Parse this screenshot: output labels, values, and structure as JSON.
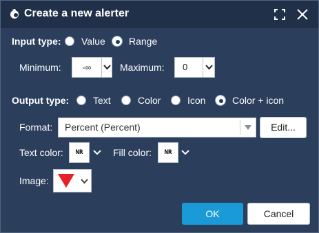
{
  "dialog": {
    "title": "Create a new alerter",
    "title_icon": "alerter-bell-icon",
    "maximize_icon": "maximize-icon",
    "close_icon": "close-icon"
  },
  "input_type": {
    "label": "Input type:",
    "options": [
      "Value",
      "Range"
    ],
    "selected": "Range"
  },
  "range": {
    "minimum_label": "Minimum:",
    "minimum_value": "-∞",
    "maximum_label": "Maximum:",
    "maximum_value": "0"
  },
  "output_type": {
    "label": "Output type:",
    "options": [
      "Text",
      "Color",
      "Icon",
      "Color + icon"
    ],
    "selected": "Color + icon"
  },
  "format": {
    "label": "Format:",
    "value": "Percent (Percent)",
    "edit_label": "Edit..."
  },
  "colors": {
    "text_color_label": "Text color:",
    "text_color_swatch": "NR",
    "fill_color_label": "Fill color:",
    "fill_color_swatch": "NR"
  },
  "image": {
    "label": "Image:",
    "icon": "red-down-triangle-icon",
    "icon_color": "#e8202a"
  },
  "buttons": {
    "ok_label": "OK",
    "cancel_label": "Cancel"
  },
  "theme": {
    "background": "#2b3e5c",
    "titlebar": "#203048",
    "primary_button": "#1a9bd7"
  }
}
